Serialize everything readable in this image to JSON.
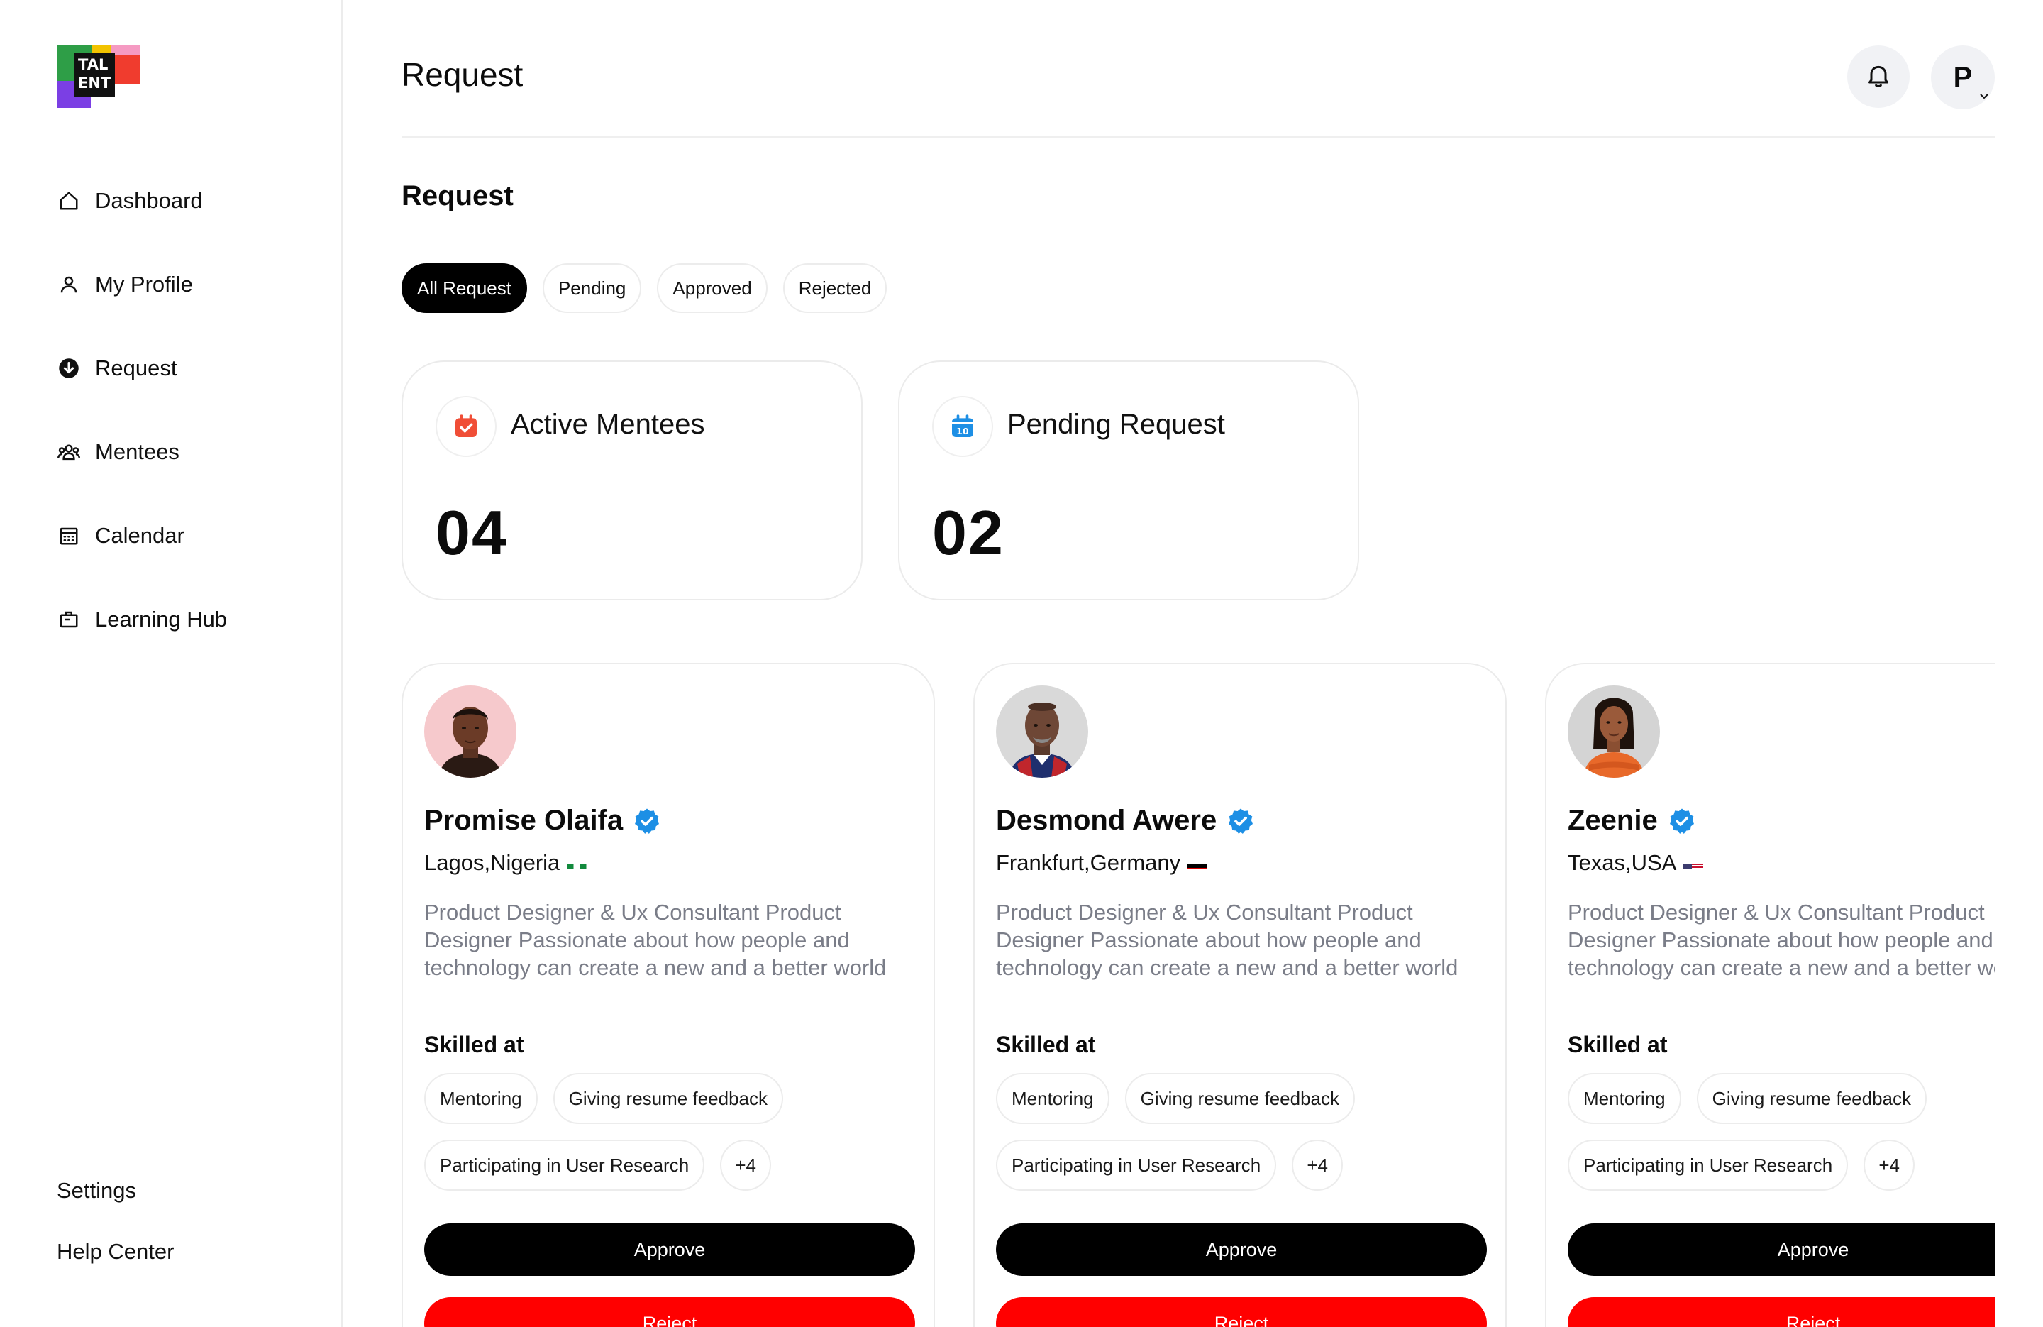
{
  "brand": {
    "logo_text_top": "TAL",
    "logo_text_bottom": "ENT"
  },
  "sidebar": {
    "items": [
      {
        "label": "Dashboard",
        "icon": "home-icon"
      },
      {
        "label": "My Profile",
        "icon": "user-icon"
      },
      {
        "label": "Request",
        "icon": "arrow-down-circle-icon"
      },
      {
        "label": "Mentees",
        "icon": "users-icon"
      },
      {
        "label": "Calendar",
        "icon": "calendar-icon"
      },
      {
        "label": "Learning Hub",
        "icon": "briefcase-icon"
      }
    ],
    "active_index": 2,
    "bottom": {
      "settings": "Settings",
      "help": "Help Center"
    }
  },
  "header": {
    "title": "Request",
    "avatar_initial": "P"
  },
  "main": {
    "section_title": "Request",
    "tabs": [
      "All Request",
      "Pending",
      "Approved",
      "Rejected"
    ],
    "active_tab": 0,
    "stats": [
      {
        "label": "Active Mentees",
        "value": "04",
        "icon": "calendar-check-icon",
        "color": "#f04e37"
      },
      {
        "label": "Pending Request",
        "value": "02",
        "icon": "calendar-date-icon",
        "color": "#1d8fe5"
      }
    ]
  },
  "mentors": [
    {
      "name": "Promise Olaifa",
      "location": "Lagos,Nigeria",
      "flag": "nigeria-flag",
      "bio": "Product Designer & Ux Consultant Product Designer Passionate about how people and technology can create a new and a better world",
      "skilled_label": "Skilled at",
      "skills_row1": [
        "Mentoring",
        "Giving resume feedback"
      ],
      "skills_row2": [
        "Participating in User Research"
      ],
      "more": "+4",
      "approve": "Approve",
      "reject": "Reject"
    },
    {
      "name": "Desmond Awere",
      "location": "Frankfurt,Germany",
      "flag": "germany-flag",
      "bio": "Product Designer & Ux Consultant Product Designer Passionate about how people and technology can create a new and a better world",
      "skilled_label": "Skilled at",
      "skills_row1": [
        "Mentoring",
        "Giving resume feedback"
      ],
      "skills_row2": [
        "Participating in User Research"
      ],
      "more": "+4",
      "approve": "Approve",
      "reject": "Reject"
    },
    {
      "name": "Zeenie",
      "location": "Texas,USA",
      "flag": "usa-flag",
      "bio": "Product Designer & Ux Consultant Product Designer Passionate about how people and technology can create a new and a better world",
      "skilled_label": "Skilled at",
      "skills_row1": [
        "Mentoring",
        "Giving resume feedback"
      ],
      "skills_row2": [
        "Participating in User Research"
      ],
      "more": "+4",
      "approve": "Approve",
      "reject": "Reject"
    }
  ],
  "colors": {
    "accent": "#000000",
    "danger": "#ff0000",
    "verified": "#1d8fe5",
    "muted_text": "#7a7d88"
  }
}
